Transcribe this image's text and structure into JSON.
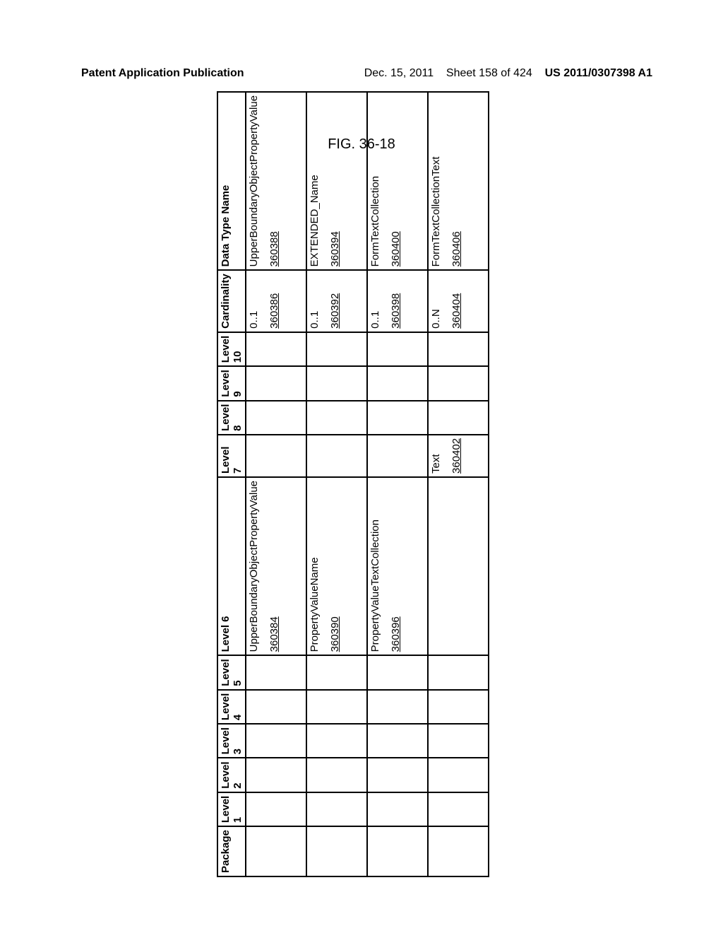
{
  "header": {
    "left": "Patent Application Publication",
    "date": "Dec. 15, 2011",
    "sheet": "Sheet 158 of 424",
    "pubno": "US 2011/0307398 A1"
  },
  "figure_label": "FIG. 36-18",
  "columns": {
    "package": "Package",
    "l1": "Level 1",
    "l2": "Level 2",
    "l3": "Level 3",
    "l4": "Level 4",
    "l5": "Level 5",
    "l6": "Level 6",
    "l7": "Level 7",
    "l8": "Level 8",
    "l9": "Level 9",
    "l10": "Level 10",
    "cardin": "Cardinality",
    "data": "Data Type Name"
  },
  "rows": [
    {
      "l6": "UpperBoundaryObjectPropertyValue",
      "l6_ref": "360384",
      "cardin": "0..1",
      "cardin_ref": "360386",
      "data": "UpperBoundaryObjectPropertyValue",
      "data_ref": "360388"
    },
    {
      "l6": "PropertyValueName",
      "l6_ref": "360390",
      "cardin": "0..1",
      "cardin_ref": "360392",
      "data": "EXTENDED_Name",
      "data_ref": "360394"
    },
    {
      "l6": "PropertyValueTextCollection",
      "l6_ref": "360396",
      "cardin": "0..1",
      "cardin_ref": "360398",
      "data": "FormTextCollection",
      "data_ref": "360400"
    },
    {
      "l7": "Text",
      "l7_ref": "360402",
      "cardin": "0..N",
      "cardin_ref": "360404",
      "data": "FormTextCollectionText",
      "data_ref": "360406"
    }
  ]
}
